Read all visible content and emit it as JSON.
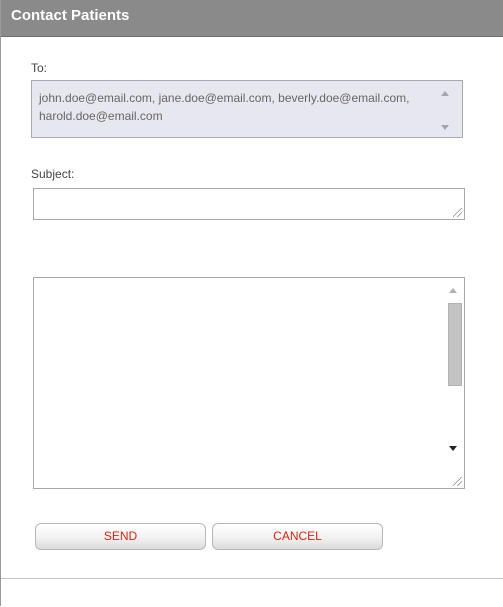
{
  "dialog": {
    "title": "Contact Patients"
  },
  "to": {
    "label": "To:",
    "value": "john.doe@email.com, jane.doe@email.com, beverly.doe@email.com, harold.doe@email.com"
  },
  "subject": {
    "label": "Subject:",
    "value": ""
  },
  "message": {
    "value": ""
  },
  "buttons": {
    "send_label": "SEND",
    "cancel_label": "CANCEL"
  },
  "colors": {
    "title_bar": "#8a8a8a",
    "button_text": "#d9230f",
    "to_box_bg": "#e7e7ef"
  },
  "icons": {
    "to_scroll_up": "chevron-up-icon",
    "to_scroll_down": "chevron-down-icon",
    "body_scroll_up": "chevron-up-icon",
    "body_scroll_down": "chevron-down-icon",
    "resize": "resize-grip-icon"
  }
}
